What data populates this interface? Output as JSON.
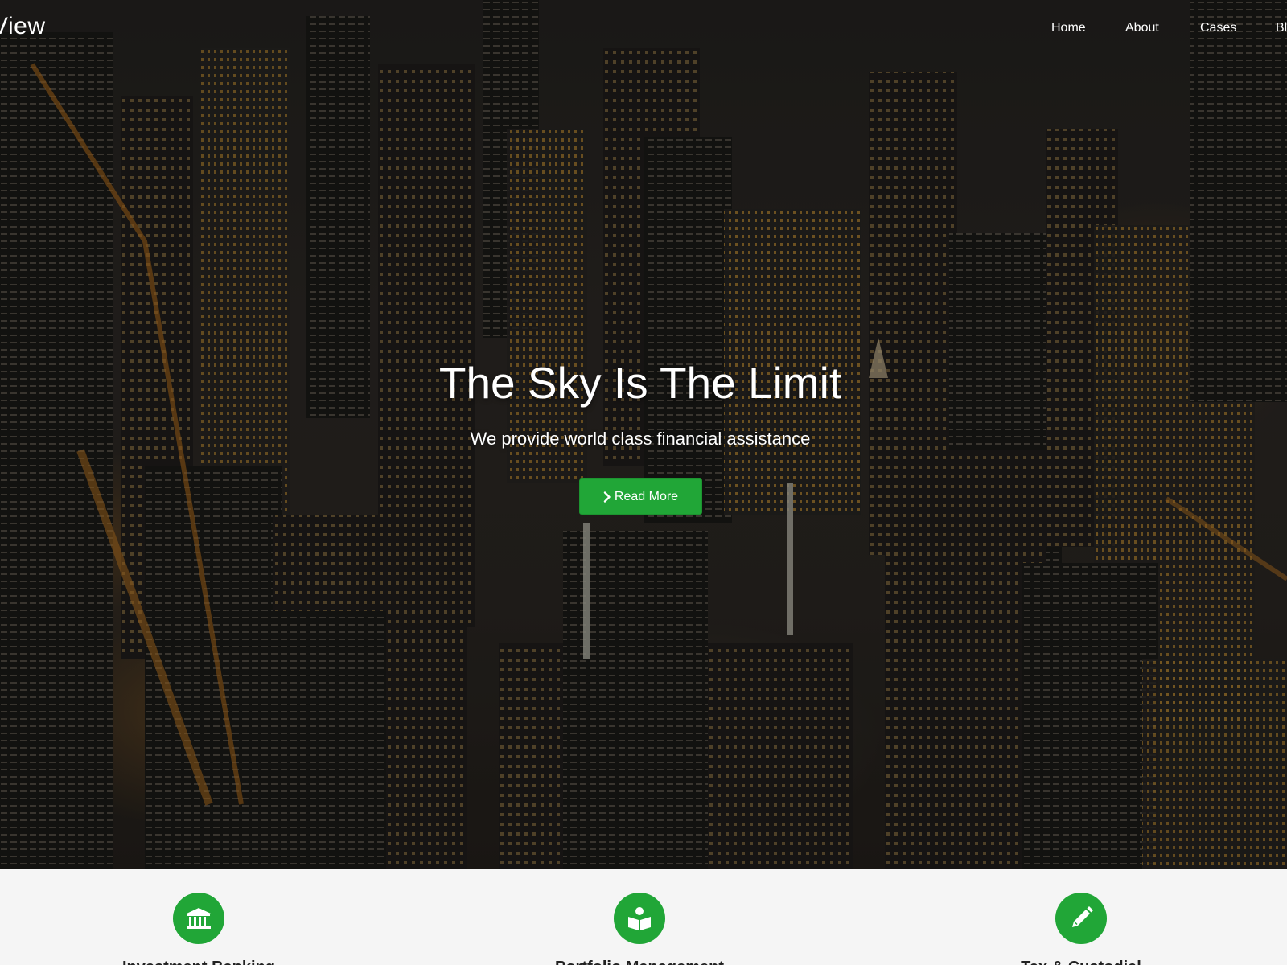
{
  "brand": {
    "text": "View"
  },
  "nav": {
    "items": [
      {
        "label": "Home"
      },
      {
        "label": "About"
      },
      {
        "label": "Cases"
      },
      {
        "label": "Bl"
      }
    ]
  },
  "hero": {
    "title": "The Sky Is The Limit",
    "subtitle": "We provide world class financial assistance",
    "cta_label": "Read More"
  },
  "features": [
    {
      "icon": "bank-icon",
      "title": "Investment Banking"
    },
    {
      "icon": "book-reader-icon",
      "title": "Portfolio Management"
    },
    {
      "icon": "pencil-icon",
      "title": "Tax & Custodial"
    }
  ],
  "colors": {
    "accent": "#21a637",
    "hero_text": "#ffffff",
    "features_bg": "#f5f5f5"
  }
}
